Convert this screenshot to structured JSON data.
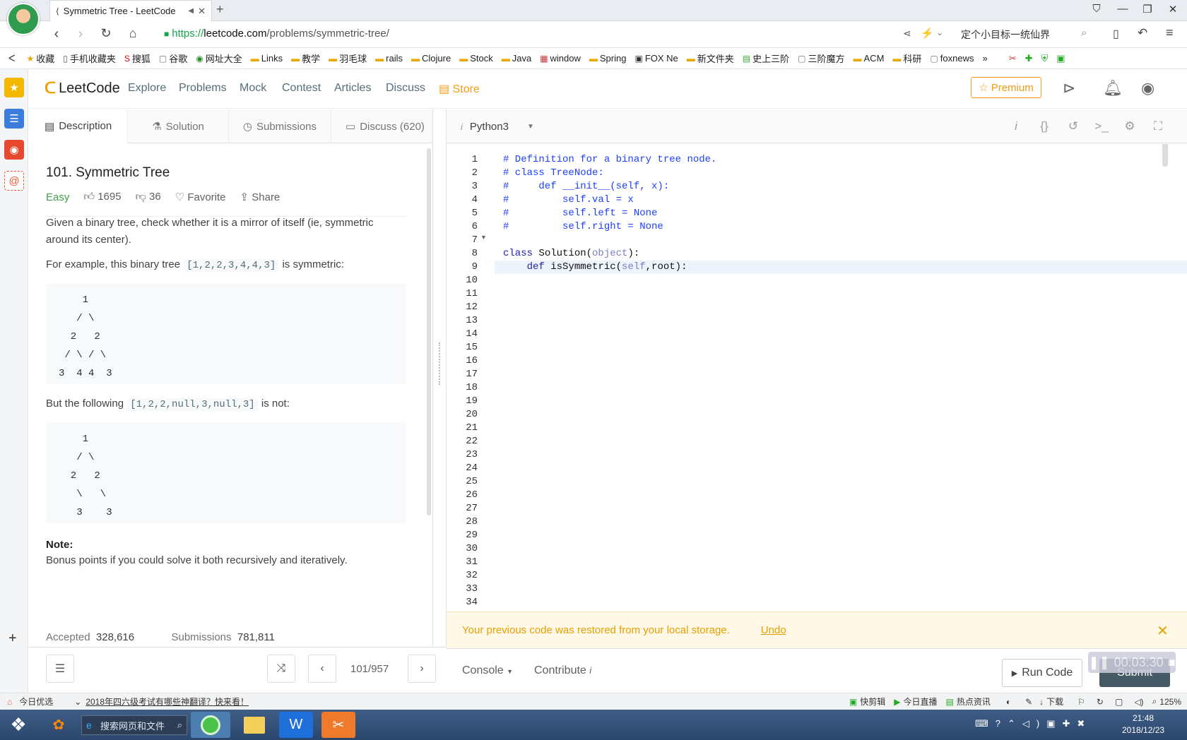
{
  "browser": {
    "tab_title": "Symmetric Tree - LeetCode",
    "url_scheme": "https://",
    "url_host": "leetcode.com",
    "url_path": "/problems/symmetric-tree/",
    "search_text": "定个小目标一统仙界",
    "bookmarks": [
      "收藏",
      "手机收藏夹",
      "搜狐",
      "谷歌",
      "网址大全",
      "Links",
      "教学",
      "羽毛球",
      "rails",
      "Clojure",
      "Stock",
      "Java",
      "window",
      "Spring",
      "FOX Ne",
      "新文件夹",
      "史上三阶",
      "三阶魔方",
      "ACM",
      "科研",
      "foxnews"
    ]
  },
  "lc_header": {
    "logo": "LeetCode",
    "nav": [
      "Explore",
      "Problems",
      "Mock",
      "Contest",
      "Articles",
      "Discuss"
    ],
    "store": "Store",
    "premium": "Premium"
  },
  "desc_tabs": [
    "Description",
    "Solution",
    "Submissions",
    "Discuss (620)"
  ],
  "problem": {
    "title": "101. Symmetric Tree",
    "difficulty": "Easy",
    "likes": "1695",
    "dislikes": "36",
    "favorite": "Favorite",
    "share": "Share",
    "p1": "Given a binary tree, check whether it is a mirror of itself (ie, symmetric around its center).",
    "p2_pre": "For example, this binary tree ",
    "p2_code": "[1,2,2,3,4,4,3]",
    "p2_post": " is symmetric:",
    "tree1": "    1\n   / \\\n  2   2\n / \\ / \\\n3  4 4  3",
    "p3_pre": "But the following ",
    "p3_code": "[1,2,2,null,3,null,3]",
    "p3_post": " is not:",
    "tree2": "    1\n   / \\\n  2   2\n   \\   \\\n   3    3",
    "note_title": "Note:",
    "note": "Bonus points if you could solve it both recursively and iteratively.",
    "accepted_label": "Accepted",
    "accepted": "328,616",
    "submissions_label": "Submissions",
    "submissions": "781,811"
  },
  "pager": "101/957",
  "editor": {
    "language": "Python3",
    "line_count": 34,
    "lines": [
      "# Definition for a binary tree node.",
      "# class TreeNode:",
      "#     def __init__(self, x):",
      "#         self.val = x",
      "#         self.left = None",
      "#         self.right = None",
      "",
      "class Solution(object):",
      "    def isSymmetric(self,root):"
    ]
  },
  "banner": {
    "text": "Your previous code was restored from your local storage.",
    "undo": "Undo"
  },
  "footer": {
    "console": "Console",
    "contribute": "Contribute",
    "timer": "00:03:30",
    "run": "Run Code",
    "submit": "Submit"
  },
  "statusbar": {
    "left": "今日优选",
    "news": "2018年四六级考试有哪些神翻译？快来看！",
    "items": [
      "快剪辑",
      "今日直播",
      "热点资讯",
      "下载"
    ],
    "zoom": "125%"
  },
  "taskbar": {
    "search": "搜索网页和文件",
    "time": "21:48",
    "date": "2018/12/23"
  }
}
